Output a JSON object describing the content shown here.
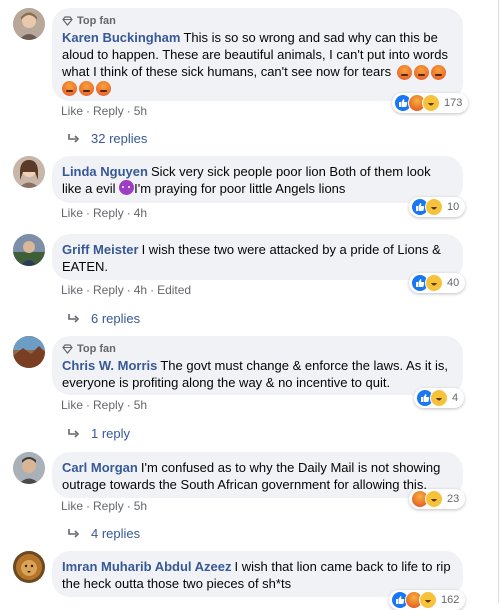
{
  "labels": {
    "top_fan": "Top fan",
    "like": "Like",
    "reply": "Reply",
    "dot": "·"
  },
  "colors": {
    "name": "#385898",
    "meta": "#65676b",
    "bubble": "#f0f2f5",
    "like": "#1877f2"
  },
  "comments": [
    {
      "author": "Karen Buckingham",
      "text": "This is so so wrong and sad why can this be aloud to happen. These are beautiful animals, I can't put into words what I think of these sick humans, can't see now for tears",
      "top_fan": true,
      "emoji": [
        "angry-face-icon",
        "angry-face-icon",
        "angry-face-icon",
        "angry-face-icon",
        "angry-face-icon",
        "angry-face-icon"
      ],
      "time": "5h",
      "edited": "",
      "reactions": [
        "like",
        "angry",
        "haha"
      ],
      "reaction_count": "173",
      "replies": "32 replies"
    },
    {
      "author": "Linda Nguyen",
      "text": "Sick very sick people poor lion Both of them look like a evil",
      "text_after": "I'm praying for poor little Angels lions",
      "top_fan": false,
      "time": "4h",
      "reactions": [
        "like",
        "haha"
      ],
      "reaction_count": "10",
      "replies": ""
    },
    {
      "author": "Griff Meister",
      "text": "I wish these two were attacked by a pride of Lions & EATEN.",
      "top_fan": false,
      "time": "4h",
      "edited": "Edited",
      "reactions": [
        "like",
        "haha"
      ],
      "reaction_count": "40",
      "replies": "6 replies"
    },
    {
      "author": "Chris W. Morris",
      "text": "The govt must change & enforce the laws. As it is, everyone is profiting along the way & no incentive to quit.",
      "top_fan": true,
      "time": "5h",
      "reactions": [
        "like",
        "haha"
      ],
      "reaction_count": "4",
      "replies": "1 reply"
    },
    {
      "author": "Carl Morgan",
      "text": "I'm confused as to why the Daily Mail is not showing outrage towards the South African government for allowing this.",
      "top_fan": false,
      "time": "5h",
      "reactions": [
        "angry",
        "haha"
      ],
      "reaction_count": "23",
      "replies": "4 replies"
    },
    {
      "author": "Imran Muharib Abdul Azeez",
      "text": "I wish that lion came back to life to rip the heck outta those two pieces of sh*ts",
      "top_fan": false,
      "reactions": [
        "like",
        "angry",
        "haha"
      ],
      "reaction_count": "162"
    }
  ]
}
